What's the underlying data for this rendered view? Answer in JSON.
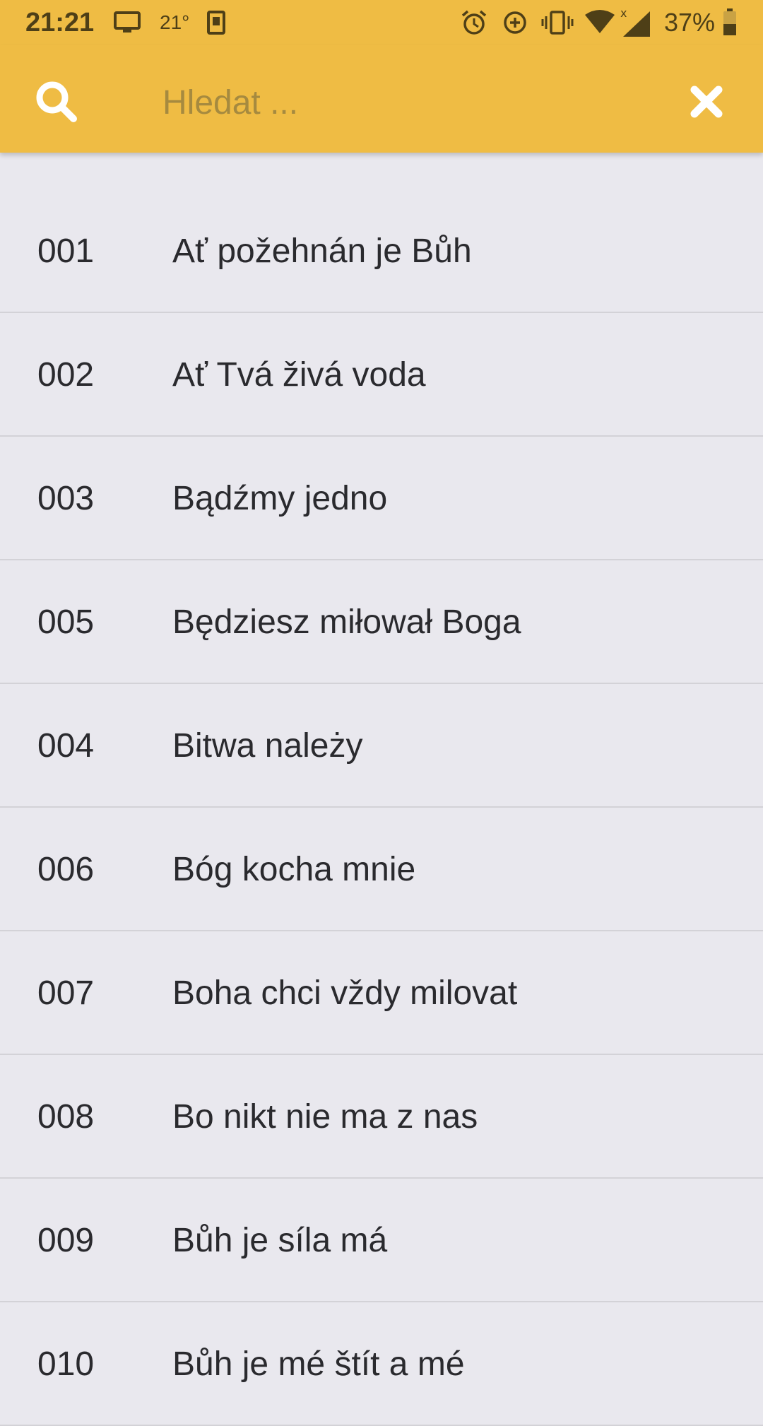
{
  "status_bar": {
    "time": "21:21",
    "temperature": "21°",
    "battery_percent": "37%",
    "icons": [
      "monitor-icon",
      "kindle-icon",
      "alarm-icon",
      "data-saver-icon",
      "vibrate-icon",
      "wifi-icon",
      "signal-icon",
      "battery-icon"
    ]
  },
  "search": {
    "placeholder": "Hledat ...",
    "value": ""
  },
  "songs": [
    {
      "number": "001",
      "title": "Ať požehnán je Bůh"
    },
    {
      "number": "002",
      "title": "Ať Tvá živá voda"
    },
    {
      "number": "003",
      "title": "Bądźmy jedno"
    },
    {
      "number": "005",
      "title": "Będziesz miłował Boga"
    },
    {
      "number": "004",
      "title": "Bitwa należy"
    },
    {
      "number": "006",
      "title": "Bóg kocha mnie"
    },
    {
      "number": "007",
      "title": "Boha chci vždy milovat"
    },
    {
      "number": "008",
      "title": "Bo nikt nie ma z nas"
    },
    {
      "number": "009",
      "title": "Bůh je síla má"
    },
    {
      "number": "010",
      "title": "Bůh je mé štít a mé"
    }
  ],
  "colors": {
    "accent": "#efbc44",
    "background": "#e9e8ee",
    "divider": "#d3d2d7"
  }
}
